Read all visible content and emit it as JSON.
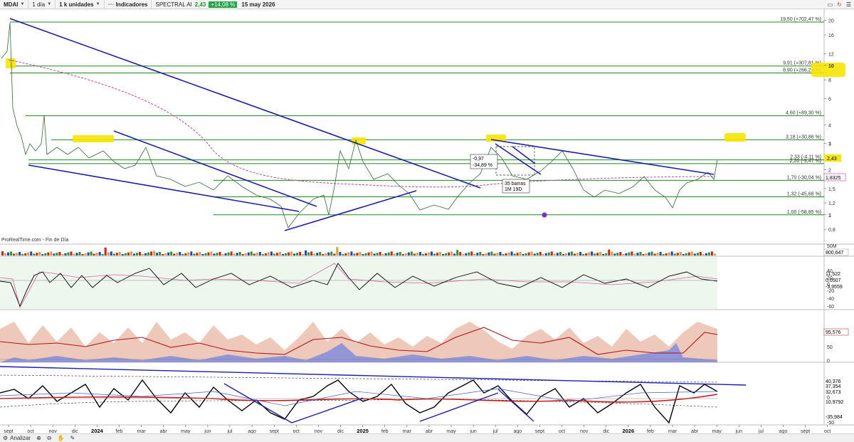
{
  "toolbar": {
    "symbol": "MDAI",
    "interval": "1 día",
    "units": "1 k unidades",
    "indicators": "Indicadores",
    "instrument": "SPECTRAL AI",
    "price": "2,43",
    "change": "+14,08 %",
    "date": "15 may 2026"
  },
  "source_label": "ProRealTime.com - Fin de Día",
  "bottom": {
    "analyze": "Analizar"
  },
  "price_axis": [
    "20",
    "16",
    "12",
    "10",
    "8",
    "6",
    "4",
    "3",
    "2",
    "1,5",
    "1,2",
    "1",
    "0,8"
  ],
  "levels": [
    {
      "label": "19,50 (+702,47 %)",
      "value": 19.5
    },
    {
      "label": "9,91 (+307,81 %)",
      "value": 9.91
    },
    {
      "label": "8,90 (+266,26 %)",
      "value": 8.9
    },
    {
      "label": "4,60 (+89,30 %)",
      "value": 4.6
    },
    {
      "label": "3,18 (+30,86 %)",
      "value": 3.18
    },
    {
      "label": "2,33 (-4,11 %)",
      "value": 2.33
    },
    {
      "label": "2,20 (-9,47 %)",
      "value": 2.2
    },
    {
      "label": "1,70 (-30,04 %)",
      "value": 1.7
    },
    {
      "label": "1,32 (-45,68 %)",
      "value": 1.32
    },
    {
      "label": "1,00 (-58,85 %)",
      "value": 1.0
    }
  ],
  "tags": {
    "last_price": "2,43",
    "ma_value": "1,8325",
    "volume_axis": "50M",
    "volume_value": "800,647",
    "osc1_axis": [
      "40",
      "20",
      "0",
      "-20",
      "-40",
      "-60"
    ],
    "osc1_values": [
      "11,522",
      "0,0507",
      "-3,9559"
    ],
    "osc2_axis": [
      "50",
      "0"
    ],
    "osc2_value": "95,576",
    "osc3_values": [
      "40,376",
      "37,354",
      "32,673",
      "10,9792",
      "-35,984"
    ],
    "osc3_axis": [
      "0",
      "-50"
    ]
  },
  "annotation": {
    "line1": "-0,97",
    "line2": "-34,89 %",
    "bars": "35 barras",
    "duration": "1M 19D"
  },
  "x_months": [
    "sept",
    "oct",
    "nov",
    "dic",
    "2024",
    "feb",
    "mar",
    "abr",
    "may",
    "jun",
    "jul",
    "ago",
    "sept",
    "oct",
    "nov",
    "dic",
    "2025",
    "feb",
    "mar",
    "abr",
    "may",
    "jun",
    "jul",
    "ago",
    "sept",
    "oct",
    "nov",
    "dic",
    "2026",
    "feb",
    "mar",
    "abr",
    "may",
    "jun",
    "jul",
    "ago",
    "sept",
    "oct"
  ],
  "colors": {
    "level_line": "#1f8a1f",
    "trend_line": "#1c1cb0",
    "ma_line": "#c03cb0",
    "highlight": "#f7e600",
    "price_line": "#000000"
  }
}
